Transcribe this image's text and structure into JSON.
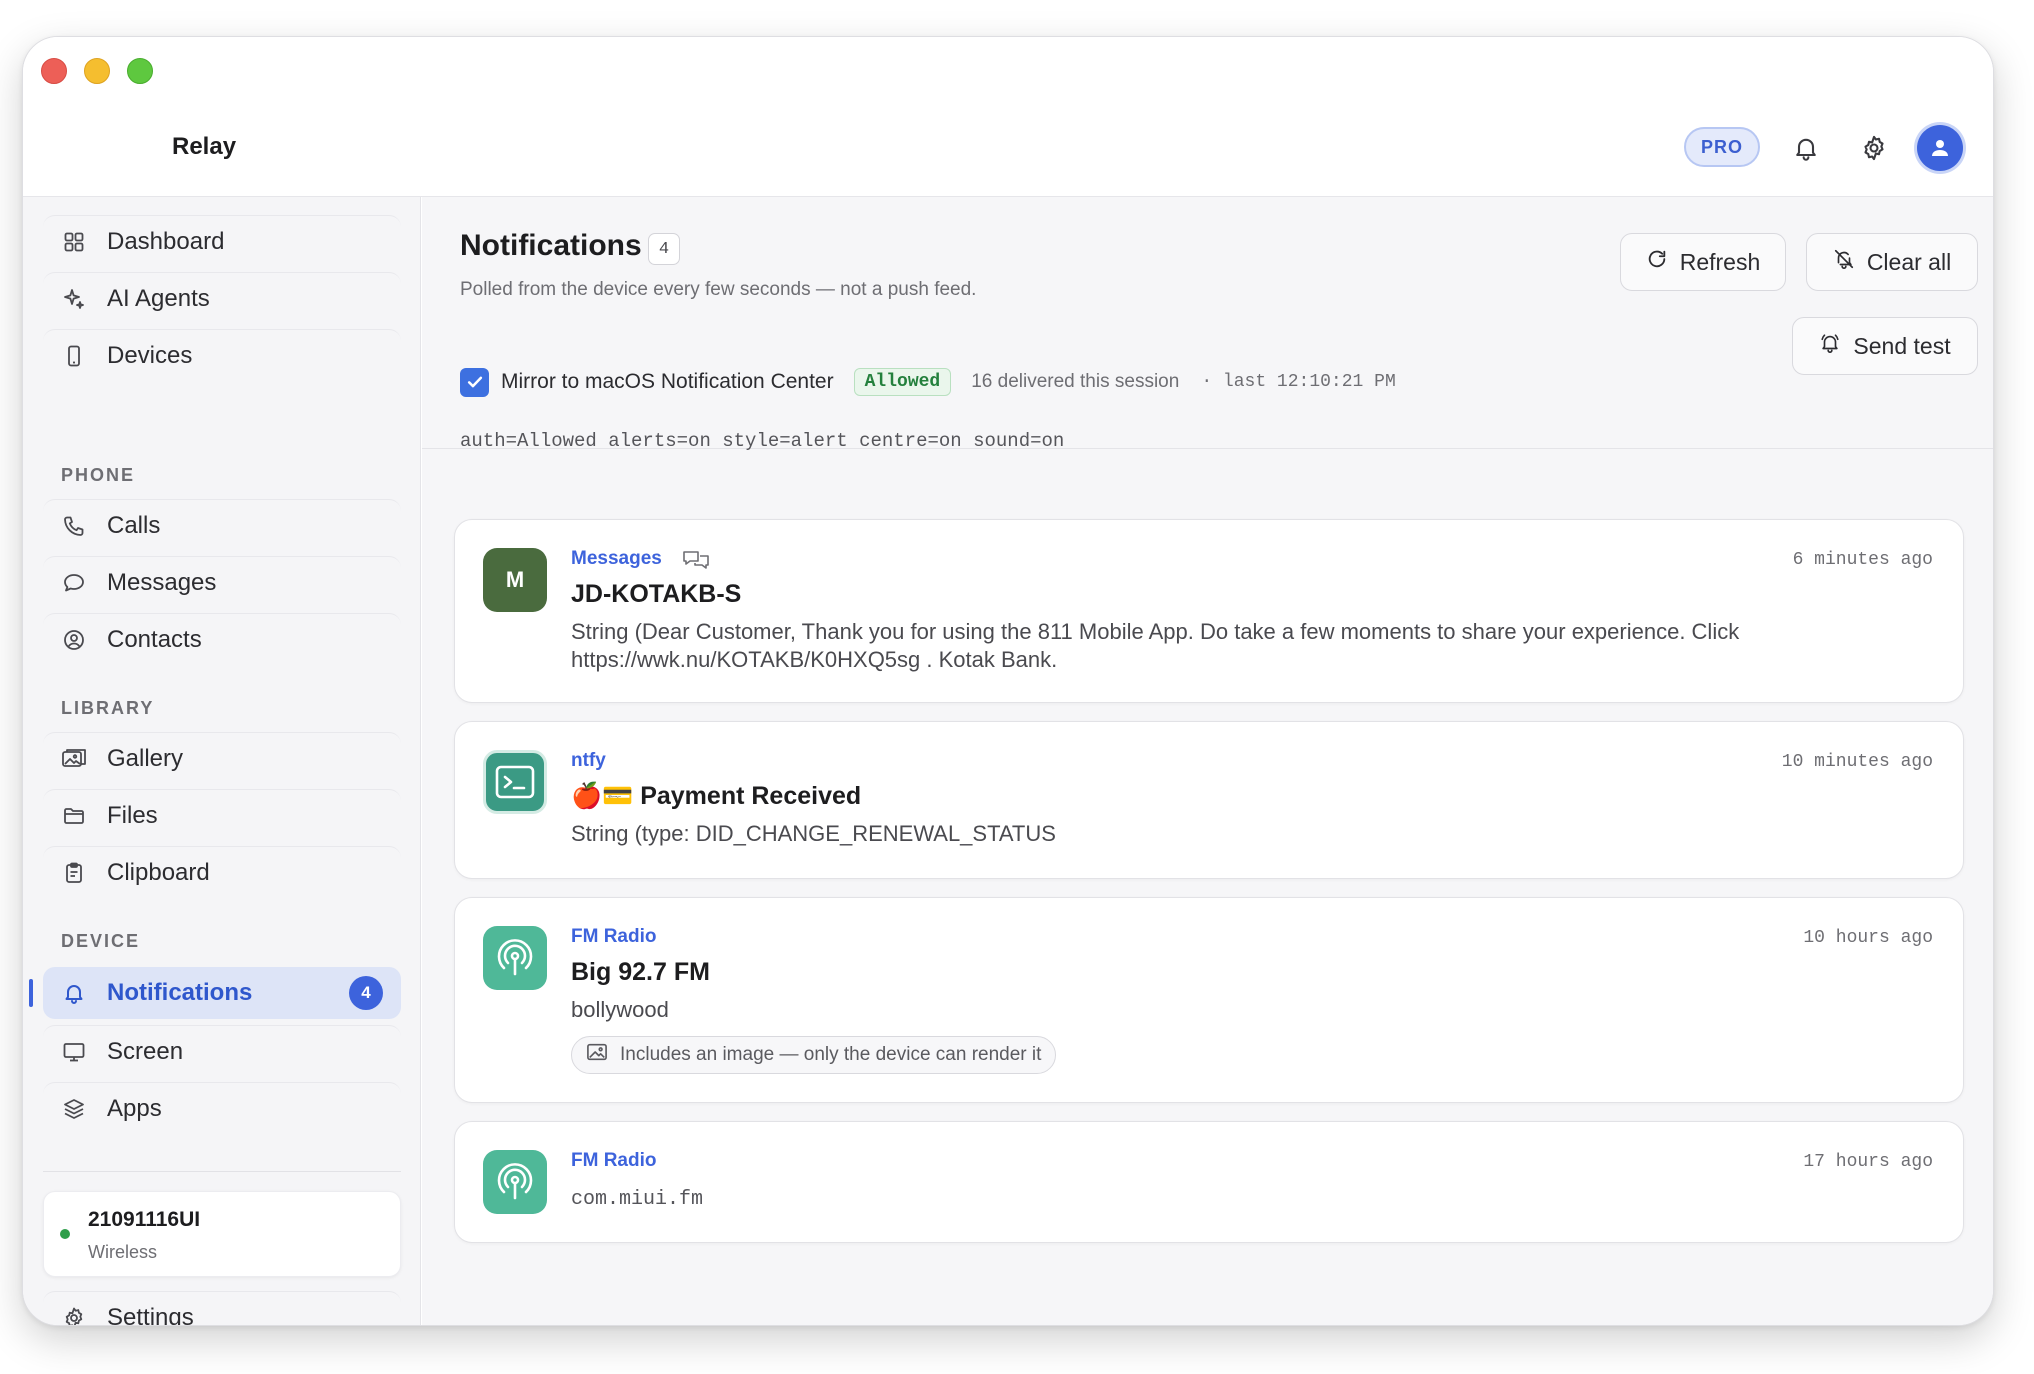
{
  "app": {
    "title": "Relay",
    "plan_badge": "PRO"
  },
  "sidebar": {
    "top_items": [
      {
        "label": "Dashboard",
        "icon": "grid-icon"
      },
      {
        "label": "AI Agents",
        "icon": "sparkle-icon"
      },
      {
        "label": "Devices",
        "icon": "phone-device-icon"
      }
    ],
    "sections": [
      {
        "title": "PHONE",
        "items": [
          {
            "label": "Calls",
            "icon": "phone-icon"
          },
          {
            "label": "Messages",
            "icon": "chat-bubble-icon"
          },
          {
            "label": "Contacts",
            "icon": "contact-icon"
          }
        ]
      },
      {
        "title": "LIBRARY",
        "items": [
          {
            "label": "Gallery",
            "icon": "gallery-icon"
          },
          {
            "label": "Files",
            "icon": "folder-icon"
          },
          {
            "label": "Clipboard",
            "icon": "clipboard-icon"
          }
        ]
      },
      {
        "title": "DEVICE",
        "items": [
          {
            "label": "Notifications",
            "icon": "bell-icon",
            "badge": "4",
            "active": true
          },
          {
            "label": "Screen",
            "icon": "monitor-icon"
          },
          {
            "label": "Apps",
            "icon": "layers-icon"
          }
        ]
      }
    ],
    "device": {
      "name": "21091116UI",
      "connection": "Wireless",
      "status_color": "#2e9e4a"
    },
    "settings_label": "Settings"
  },
  "header": {
    "title": "Notifications",
    "count": "4",
    "subtitle": "Polled from the device every few seconds — not a push feed.",
    "refresh_label": "Refresh",
    "clear_label": "Clear all",
    "send_test_label": "Send test",
    "mirror": {
      "label": "Mirror to macOS Notification Center",
      "checked": true,
      "status": "Allowed",
      "delivered": "16 delivered this session",
      "last": "· last 12:10:21 PM"
    },
    "status_line": "auth=Allowed alerts=on style=alert centre=on sound=on"
  },
  "notifications": [
    {
      "app": "Messages",
      "icon_letter": "M",
      "time": "6 minutes ago",
      "title": "JD-KOTAKB-S",
      "body": "String (Dear Customer, Thank you for using the 811 Mobile App. Do take a few moments to share your experience. Click https://wwk.nu/KOTAKB/K0HXQ5sg . Kotak Bank."
    },
    {
      "app": "ntfy",
      "time": "10 minutes ago",
      "title": "🍎💳 Payment Received",
      "body": "String (type: DID_CHANGE_RENEWAL_STATUS"
    },
    {
      "app": "FM Radio",
      "time": "10 hours ago",
      "title": "Big 92.7 FM",
      "body": "bollywood",
      "image_note": "Includes an image — only the device can render it"
    },
    {
      "app": "FM Radio",
      "time": "17 hours ago",
      "body": "com.miui.fm"
    }
  ],
  "colors": {
    "accent": "#3d63dc",
    "allowed_green": "#24803d",
    "messages_icon": "#4a6b3e",
    "ntfy_icon": "#3b9a84",
    "radio_icon": "#4fb898"
  }
}
